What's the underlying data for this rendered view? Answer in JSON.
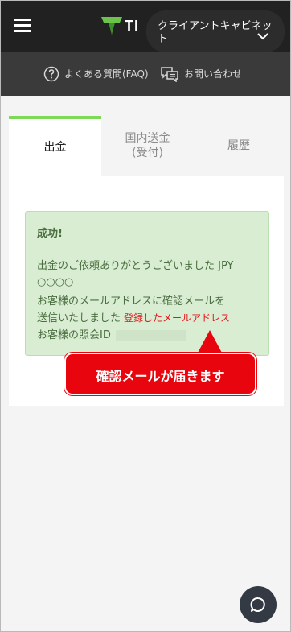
{
  "header": {
    "logo_text": "TI",
    "cabinet_label": "クライアントキャビネット",
    "logo_color": "#6cc24a"
  },
  "subnav": {
    "faq_label": "よくある質問(FAQ)",
    "contact_label": "お問い合わせ",
    "faq_icon": "question-circle-icon",
    "contact_icon": "chat-bubbles-icon"
  },
  "tabs": [
    {
      "label": "出金",
      "active": true
    },
    {
      "label": "国内送金\n(受付)",
      "active": false
    },
    {
      "label": "履歴",
      "active": false
    }
  ],
  "alert": {
    "title": "成功!",
    "line1": "出金のご依頼ありがとうございました JPY",
    "line2": "○○○○",
    "line3": "お客様のメールアドレスに確認メールを",
    "line4_prefix": "送信いたしました",
    "line4_note": "登録したメールアドレス",
    "line5_prefix": "お客様の照会ID",
    "bg_color": "#d9edd3",
    "text_color": "#4a6e3f"
  },
  "callout": {
    "text": "確認メールが届きます",
    "color": "#e8050d"
  },
  "chat": {
    "icon": "chat-icon"
  }
}
